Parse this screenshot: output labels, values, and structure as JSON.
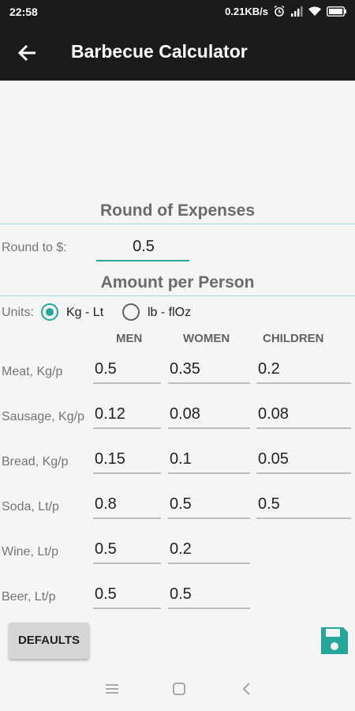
{
  "status": {
    "time": "22:58",
    "network": "0.21KB/s"
  },
  "appbar": {
    "title": "Barbecue Calculator"
  },
  "round": {
    "title": "Round of Expenses",
    "label": "Round to $:",
    "value": "0.5"
  },
  "amount": {
    "title": "Amount per Person",
    "units_label": "Units:",
    "unit_options": [
      "Kg - Lt",
      "lb - flOz"
    ],
    "selected_unit": "Kg - Lt",
    "columns": [
      "MEN",
      "WOMEN",
      "CHILDREN"
    ],
    "rows": [
      {
        "label": "Meat, Kg/p",
        "men": "0.5",
        "women": "0.35",
        "children": "0.2"
      },
      {
        "label": "Sausage, Kg/p",
        "men": "0.12",
        "women": "0.08",
        "children": "0.08"
      },
      {
        "label": "Bread, Kg/p",
        "men": "0.15",
        "women": "0.1",
        "children": "0.05"
      },
      {
        "label": "Soda, Lt/p",
        "men": "0.8",
        "women": "0.5",
        "children": "0.5"
      },
      {
        "label": "Wine, Lt/p",
        "men": "0.5",
        "women": "0.2"
      },
      {
        "label": "Beer, Lt/p",
        "men": "0.5",
        "women": "0.5"
      }
    ]
  },
  "buttons": {
    "defaults": "DEFAULTS"
  },
  "icons": {
    "back": "arrow-back-icon",
    "save": "save-icon",
    "accent": "#26a69a",
    "appbar": "#1b1b1b"
  }
}
